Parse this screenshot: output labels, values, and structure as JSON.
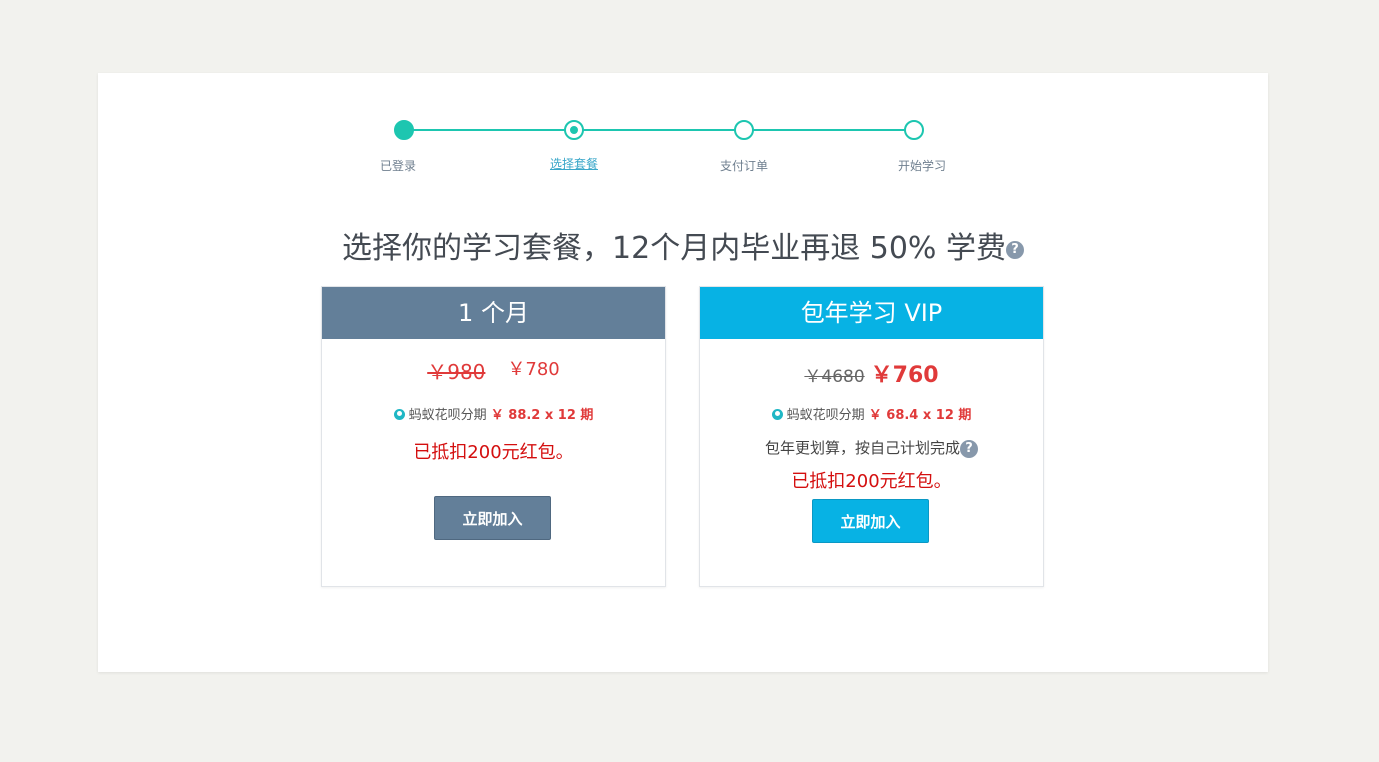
{
  "colors": {
    "accent_teal": "#1dc6b0",
    "plan1_header": "#637f99",
    "plan2_header": "#07b2e4",
    "price_red": "#e03a3a"
  },
  "stepper": {
    "steps": [
      {
        "label": "已登录",
        "state": "done"
      },
      {
        "label": "选择套餐",
        "state": "current"
      },
      {
        "label": "支付订单",
        "state": "todo"
      },
      {
        "label": "开始学习",
        "state": "todo"
      }
    ]
  },
  "headline": {
    "text": "选择你的学习套餐，12个月内毕业再退 50% 学费",
    "help_icon": "question-circle-icon",
    "help_glyph": "?"
  },
  "plans": [
    {
      "title": "1 个月",
      "old_price": "￥980",
      "new_price": "￥780",
      "installment_label": "蚂蚁花呗分期",
      "installment_amount": "￥ 88.2 x 12 期",
      "coupon": "已抵扣200元红包。",
      "button": "立即加入"
    },
    {
      "title": "包年学习 VIP",
      "old_price": "￥4680",
      "new_price": "￥760",
      "installment_label": "蚂蚁花呗分期",
      "installment_amount": "￥ 68.4 x 12 期",
      "note": "包年更划算，按自己计划完成",
      "coupon": "已抵扣200元红包。",
      "button": "立即加入"
    }
  ]
}
